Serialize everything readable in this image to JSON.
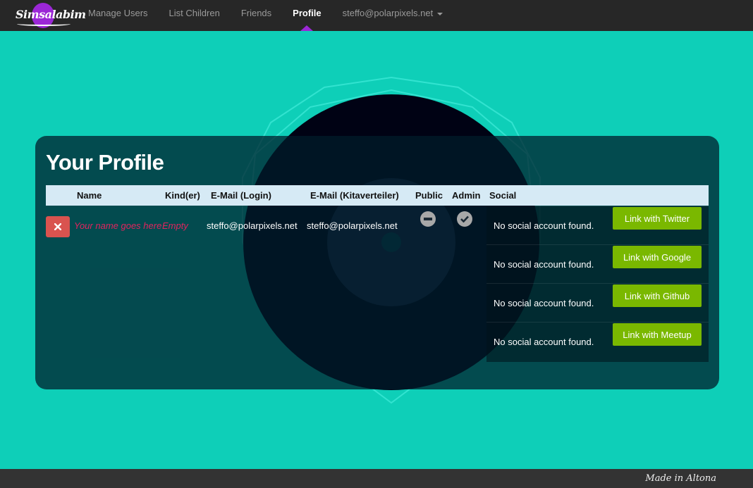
{
  "navbar": {
    "brand": "Simsalabim",
    "items": [
      {
        "label": "Manage Users"
      },
      {
        "label": "List Children"
      },
      {
        "label": "Friends"
      },
      {
        "label": "Profile"
      }
    ],
    "user_menu": "steffo@polarpixels.net",
    "active": "Profile"
  },
  "profile": {
    "title": "Your Profile",
    "columns": [
      "Name",
      "Kind(er)",
      "E-Mail (Login)",
      "E-Mail (Kitaverteiler)",
      "Public",
      "Admin",
      "Social"
    ],
    "row": {
      "name": "Your name goes here",
      "children": "Empty",
      "email_login": "steffo@polarpixels.net",
      "email_kitaverteiler": "steffo@polarpixels.net",
      "public_icon": "minus-circle-icon",
      "admin_icon": "check-circle-icon"
    },
    "social": [
      {
        "status": "No social account found.",
        "button": "Link with Twitter"
      },
      {
        "status": "No social account found.",
        "button": "Link with Google"
      },
      {
        "status": "No social account found.",
        "button": "Link with Github"
      },
      {
        "status": "No social account found.",
        "button": "Link with Meetup"
      }
    ]
  },
  "footer": {
    "text": "Made in Altona"
  },
  "colors": {
    "background": "#0ecfb8",
    "navbar": "#272727",
    "accent": "#9b27d6",
    "button_green": "#7ab800",
    "delete_red": "#d9534f",
    "empty_text": "#e0245e"
  }
}
